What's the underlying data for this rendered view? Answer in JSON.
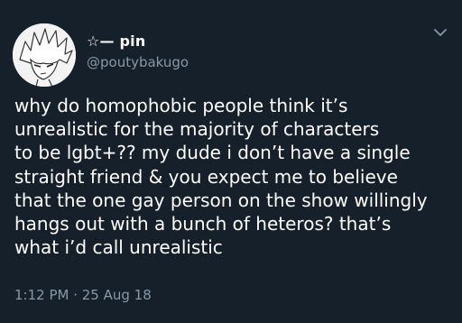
{
  "tweet": {
    "display_name": "☆— pin",
    "handle": "@poutybakugo",
    "avatar_icon": "anime-character-avatar",
    "menu_icon": "chevron-down-icon",
    "body_lines": [
      "why do homophobic people think it’s",
      "unrealistic for the majority of characters",
      "to be lgbt+?? my dude i don’t have a single",
      "straight friend & you expect me to believe",
      "that the one gay person on the show willingly",
      "hangs out with a bunch of heteros? that’s",
      "what i’d call unrealistic"
    ],
    "timestamp": "1:12 PM · 25 Aug 18"
  },
  "colors": {
    "background": "#15202b",
    "text_primary": "#ffffff",
    "text_secondary": "#8899a6"
  }
}
